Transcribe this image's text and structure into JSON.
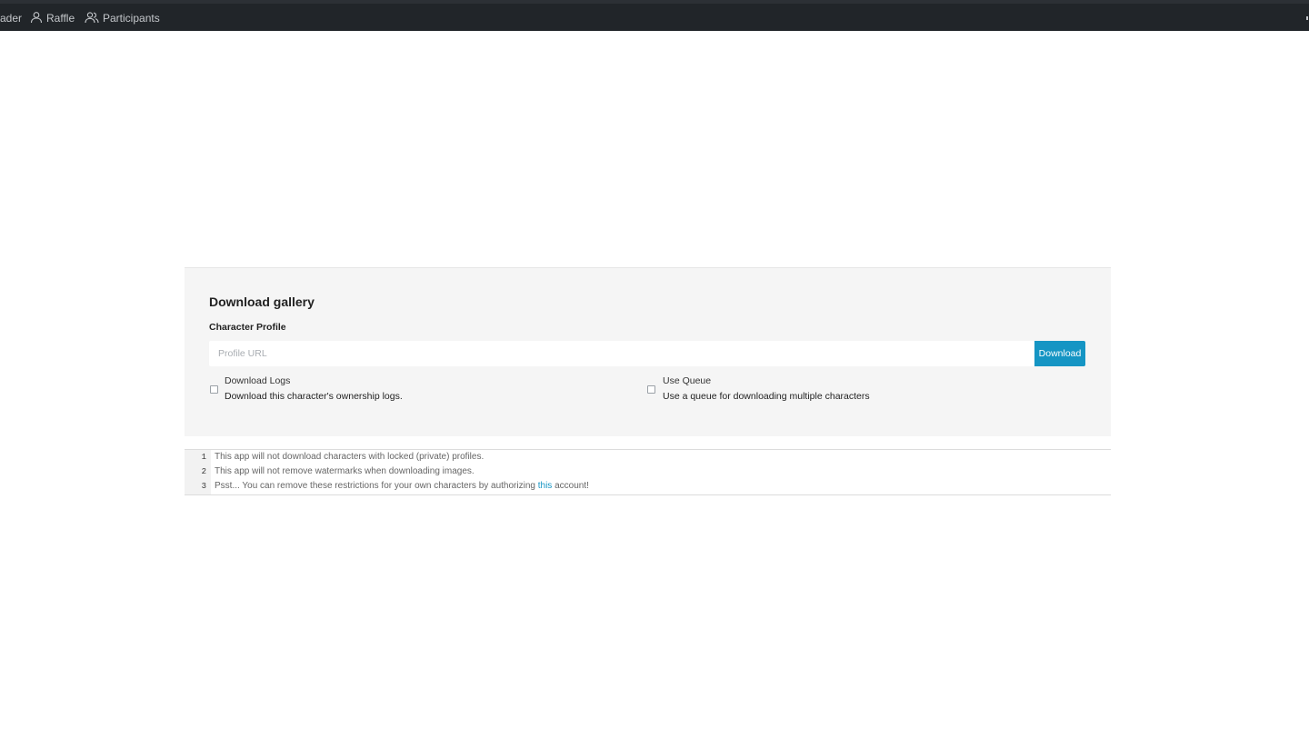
{
  "nav": {
    "items": [
      {
        "label": "ader",
        "icon": ""
      },
      {
        "label": "Raffle",
        "icon": "user-icon"
      },
      {
        "label": "Participants",
        "icon": "users-icon"
      }
    ]
  },
  "card": {
    "title": "Download gallery",
    "field_label": "Character Profile",
    "input_placeholder": "Profile URL",
    "input_value": "",
    "button_label": "Download",
    "options": [
      {
        "title": "Download Logs",
        "description": "Download this character's ownership logs.",
        "checked": false
      },
      {
        "title": "Use Queue",
        "description": "Use a queue for downloading multiple characters",
        "checked": false
      }
    ]
  },
  "notes": [
    {
      "num": "1",
      "text": "This app will not download characters with locked (private) profiles."
    },
    {
      "num": "2",
      "text": "This app will not remove watermarks when downloading images."
    },
    {
      "num": "3",
      "text_before": "Psst... You can remove these restrictions for your own characters by authorizing",
      "link": "this",
      "text_after": "account!"
    }
  ],
  "colors": {
    "navbar": "#212529",
    "accent": "#1595c4",
    "card_bg": "#f5f5f5"
  }
}
